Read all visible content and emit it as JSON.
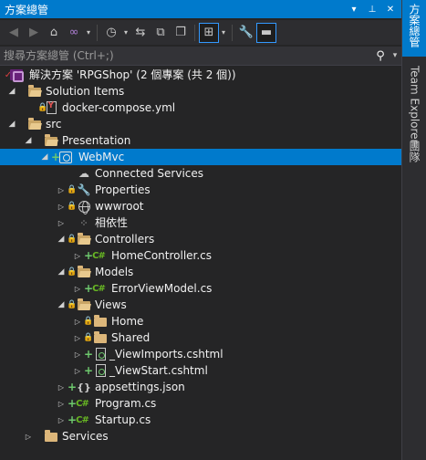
{
  "window": {
    "title": "方案總管",
    "dropdown_icon": "chevron-down-icon",
    "pin_icon": "pin-icon",
    "close_icon": "close-icon"
  },
  "toolbar": {
    "icons": [
      "back-icon",
      "forward-icon",
      "home-icon",
      "vs-icon",
      "history-icon",
      "sync-icon",
      "collapse-all-icon",
      "copy-icon",
      "show-all-files-icon",
      "properties-icon",
      "preview-icon"
    ]
  },
  "search": {
    "placeholder": "搜尋方案總管 (Ctrl+;)",
    "icon": "search-icon"
  },
  "tree": {
    "solution": "解決方案 'RPGShop' (2 個專案 (共 2 個))",
    "solution_items": "Solution Items",
    "docker_compose": "docker-compose.yml",
    "src": "src",
    "presentation": "Presentation",
    "webmvc": "WebMvc",
    "connected_services": "Connected Services",
    "properties": "Properties",
    "wwwroot": "wwwroot",
    "dependencies": "相依性",
    "controllers": "Controllers",
    "home_controller": "HomeController.cs",
    "models": "Models",
    "error_view_model": "ErrorViewModel.cs",
    "views": "Views",
    "home": "Home",
    "shared": "Shared",
    "view_imports": "_ViewImports.cshtml",
    "view_start": "_ViewStart.cshtml",
    "appsettings": "appsettings.json",
    "program": "Program.cs",
    "startup": "Startup.cs",
    "services": "Services"
  },
  "sidebar": {
    "tabs": [
      "方案總管",
      "Team Explorer",
      "團隊"
    ]
  },
  "colors": {
    "accent": "#007acc",
    "background": "#252526",
    "folder": "#dcb67a",
    "csharp": "#68b723"
  }
}
